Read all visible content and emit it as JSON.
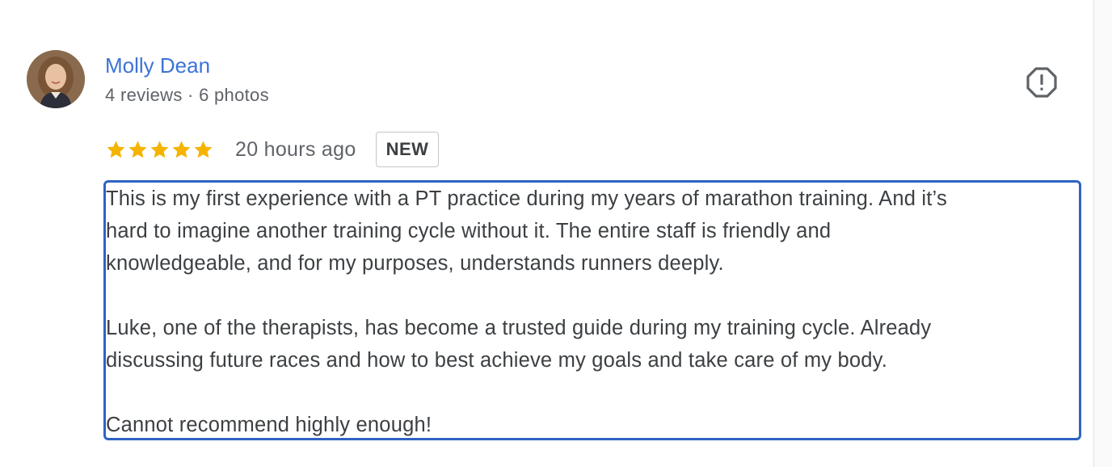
{
  "reviewer": {
    "name": "Molly Dean",
    "meta": "4 reviews · 6 photos"
  },
  "rating": {
    "stars": 5,
    "max_stars": 5,
    "time_ago": "20 hours ago",
    "badge": "NEW"
  },
  "review": {
    "lines": [
      "This is my first experience with a PT practice during my years of marathon training. And it’s",
      "hard to imagine another training cycle without it. The entire staff is friendly and",
      "knowledgeable, and for my purposes, understands runners deeply.",
      "",
      "Luke, one of the therapists, has become a trusted guide during my training cycle. Already",
      "discussing future races and how to best achieve my goals and take care of my body.",
      "",
      "Cannot recommend highly enough!"
    ]
  },
  "icons": {
    "report": "report-flag-icon",
    "star": "star-icon"
  },
  "colors": {
    "name_link": "#3b74d6",
    "star": "#f4b400",
    "selection_border": "#2f63c4",
    "meta_text": "#5f6368"
  }
}
